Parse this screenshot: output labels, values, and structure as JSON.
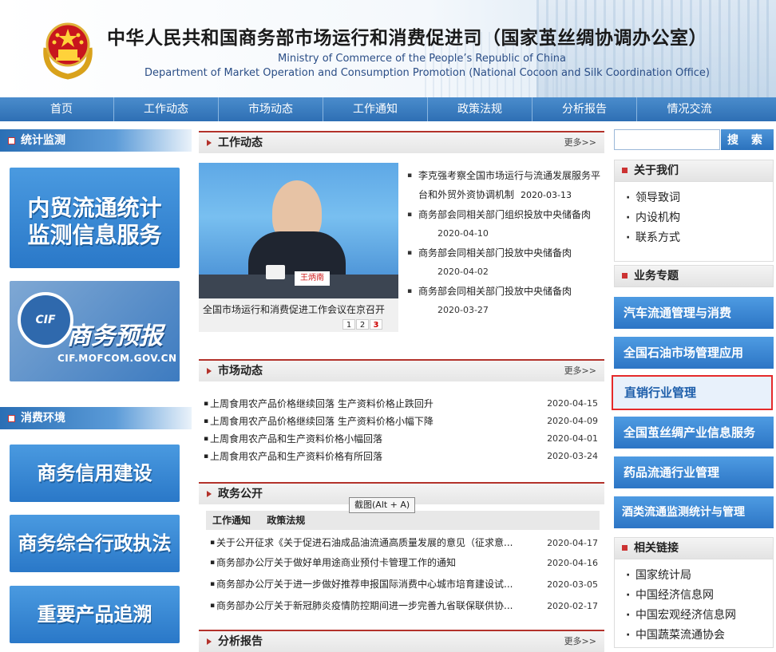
{
  "header": {
    "title_cn": "中华人民共和国商务部市场运行和消费促进司（国家茧丝绸协调办公室）",
    "title_en1": "Ministry of Commerce of the People’s Republic of China",
    "title_en2": "Department of Market Operation and Consumption Promotion (National Cocoon and Silk Coordination Office)"
  },
  "nav": [
    "首页",
    "工作动态",
    "市场动态",
    "工作通知",
    "政策法规",
    "分析报告",
    "情况交流"
  ],
  "left": {
    "section1": "统计监测",
    "banner1": "内贸流通统计监测信息服务",
    "banner2_logo": "CIF",
    "banner2_title": "商务预报",
    "banner2_url": "CIF.MOFCOM.GOV.CN",
    "section2": "消费环境",
    "banners": [
      "商务信用建设",
      "商务综合行政执法",
      "重要产品追溯"
    ]
  },
  "work": {
    "title": "工作动态",
    "more": "更多>>",
    "photo_caption": "全国市场运行和消费促进工作会议在京召开",
    "nameplate": "王炳南",
    "pager": [
      "1",
      "2",
      "3"
    ],
    "items": [
      {
        "text": "李克强考察全国市场运行与流通发展服务平台和外贸外资协调机制",
        "date": "2020-03-13"
      },
      {
        "text": "商务部会同相关部门组织投放中央储备肉",
        "date": "2020-04-10"
      },
      {
        "text": "商务部会同相关部门投放中央储备肉",
        "date": "2020-04-02"
      },
      {
        "text": "商务部会同相关部门投放中央储备肉",
        "date": "2020-03-27"
      }
    ]
  },
  "market": {
    "title": "市场动态",
    "more": "更多>>",
    "items": [
      {
        "text": "上周食用农产品价格继续回落 生产资料价格止跌回升",
        "date": "2020-04-15"
      },
      {
        "text": "上周食用农产品价格继续回落 生产资料价格小幅下降",
        "date": "2020-04-09"
      },
      {
        "text": "上周食用农产品和生产资料价格小幅回落",
        "date": "2020-04-01"
      },
      {
        "text": "上周食用农产品和生产资料价格有所回落",
        "date": "2020-03-24"
      }
    ]
  },
  "gov": {
    "title": "政务公开",
    "tabs": [
      "工作通知",
      "政策法规"
    ],
    "tooltip": "截图(Alt + A)",
    "items": [
      {
        "text": "关于公开征求《关于促进石油成品油流通高质量发展的意见（征求意...",
        "date": "2020-04-17"
      },
      {
        "text": "商务部办公厅关于做好单用途商业预付卡管理工作的通知",
        "date": "2020-04-16"
      },
      {
        "text": "商务部办公厅关于进一步做好推荐申报国际消费中心城市培育建设试...",
        "date": "2020-03-05"
      },
      {
        "text": "商务部办公厅关于新冠肺炎疫情防控期间进一步完善九省联保联供协...",
        "date": "2020-02-17"
      }
    ]
  },
  "report": {
    "title": "分析报告",
    "more": "更多>>"
  },
  "right": {
    "search_button": "搜 索",
    "about_title": "关于我们",
    "about_items": [
      "领导致词",
      "内设机构",
      "联系方式"
    ],
    "topics_title": "业务专题",
    "topics": [
      "汽车流通管理与消费",
      "全国石油市场管理应用",
      "直销行业管理",
      "全国茧丝绸产业信息服务",
      "药品流通行业管理",
      "酒类流通监测统计与管理"
    ],
    "links_title": "相关链接",
    "links": [
      "国家统计局",
      "中国经济信息网",
      "中国宏观经济信息网",
      "中国蔬菜流通协会"
    ]
  }
}
